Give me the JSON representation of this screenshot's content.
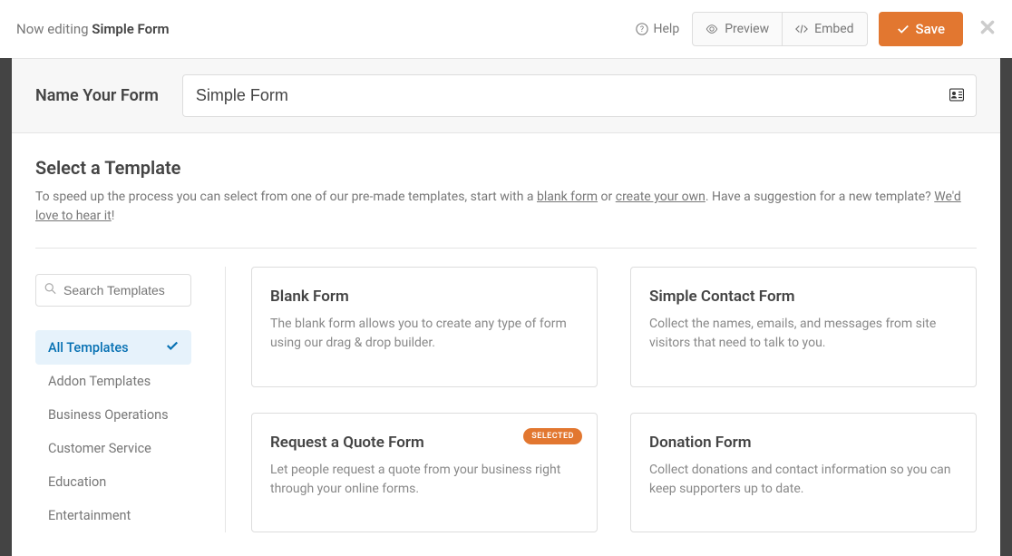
{
  "topbar": {
    "editing_prefix": "Now editing ",
    "editing_name": "Simple Form",
    "help": "Help",
    "preview": "Preview",
    "embed": "Embed",
    "save": "Save"
  },
  "name_section": {
    "label": "Name Your Form",
    "value": "Simple Form"
  },
  "template_section": {
    "title": "Select a Template",
    "desc_prefix": "To speed up the process you can select from one of our pre-made templates, start with a ",
    "blank_link": "blank form",
    "desc_or": " or ",
    "create_link": "create your own",
    "desc_suffix": ". Have a suggestion for a new template? ",
    "hear_link": "We'd love to hear it",
    "desc_end": "!"
  },
  "search": {
    "placeholder": "Search Templates"
  },
  "categories": [
    {
      "label": "All Templates",
      "active": true
    },
    {
      "label": "Addon Templates",
      "active": false
    },
    {
      "label": "Business Operations",
      "active": false
    },
    {
      "label": "Customer Service",
      "active": false
    },
    {
      "label": "Education",
      "active": false
    },
    {
      "label": "Entertainment",
      "active": false
    }
  ],
  "templates": [
    {
      "title": "Blank Form",
      "desc": "The blank form allows you to create any type of form using our drag & drop builder.",
      "selected": false
    },
    {
      "title": "Simple Contact Form",
      "desc": "Collect the names, emails, and messages from site visitors that need to talk to you.",
      "selected": false
    },
    {
      "title": "Request a Quote Form",
      "desc": "Let people request a quote from your business right through your online forms.",
      "selected": true
    },
    {
      "title": "Donation Form",
      "desc": "Collect donations and contact information so you can keep supporters up to date.",
      "selected": false
    }
  ],
  "badge": {
    "selected": "SELECTED"
  }
}
